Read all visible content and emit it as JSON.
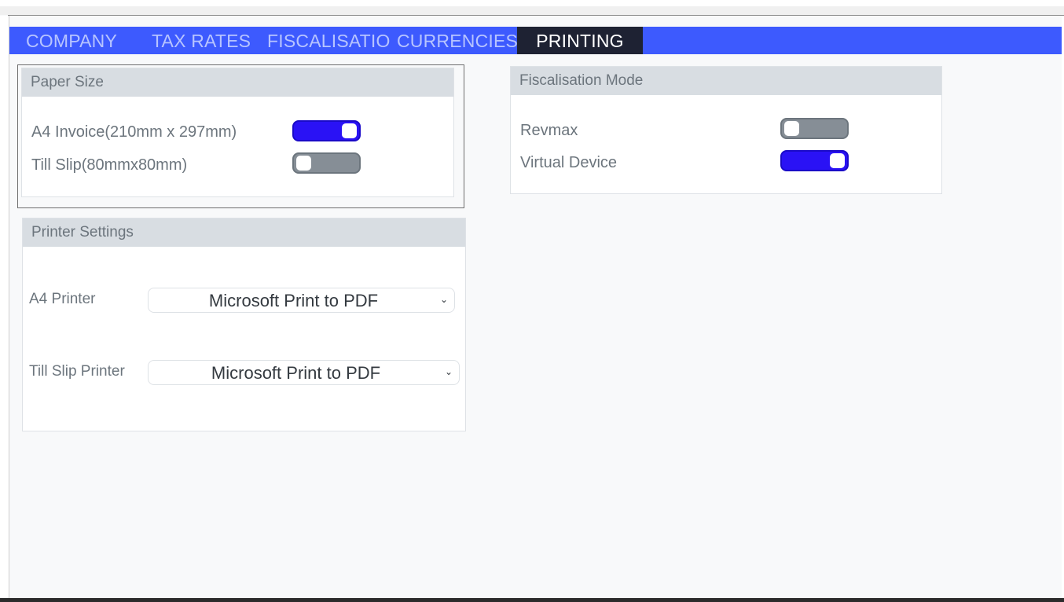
{
  "tabs": [
    {
      "label": "COMPANY",
      "active": false
    },
    {
      "label": "TAX RATES",
      "active": false
    },
    {
      "label": "FISCALISATIO",
      "active": false
    },
    {
      "label": "CURRENCIES",
      "active": false
    },
    {
      "label": "PRINTING",
      "active": true
    }
  ],
  "paper_size": {
    "title": "Paper Size",
    "options": [
      {
        "label": "A4 Invoice(210mm x 297mm)",
        "enabled": true
      },
      {
        "label": "Till Slip(80mmx80mm)",
        "enabled": false
      }
    ]
  },
  "fiscalisation_mode": {
    "title": "Fiscalisation Mode",
    "options": [
      {
        "label": "Revmax",
        "enabled": false
      },
      {
        "label": "Virtual Device",
        "enabled": true
      }
    ]
  },
  "printer_settings": {
    "title": "Printer Settings",
    "a4_printer": {
      "label": "A4 Printer",
      "value": "Microsoft Print to PDF"
    },
    "till_slip_printer": {
      "label": "Till Slip Printer",
      "value": "Microsoft Print to PDF"
    }
  },
  "icons": {
    "chevron": "chevron-down-icon"
  },
  "colors": {
    "tabbar": "#3d5afe",
    "active_tab": "#1e2233",
    "toggle_on": "#2a12f5",
    "toggle_off": "#868e96",
    "card_header": "#d8dde2"
  }
}
